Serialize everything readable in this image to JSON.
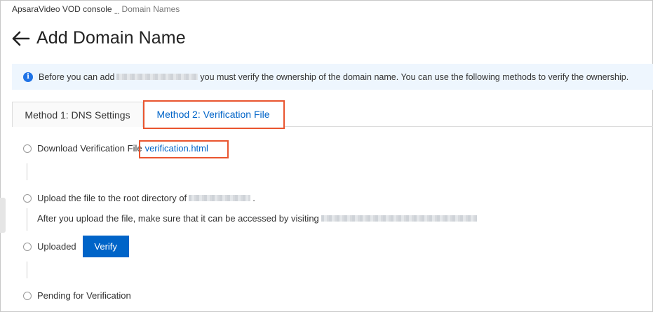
{
  "breadcrumb": {
    "item_1": "ApsaraVideo VOD console",
    "separator": "...",
    "item_2": "Domain Names"
  },
  "page": {
    "title": "Add Domain Name"
  },
  "info": {
    "text_before": "Before you can add",
    "text_after": "you must verify the ownership of the domain name. You can use the following methods to verify the ownership.",
    "icon": "info-icon"
  },
  "tabs": [
    {
      "label": "Method 1: DNS Settings",
      "active": false
    },
    {
      "label": "Method 2: Verification File",
      "active": true
    }
  ],
  "steps": {
    "download_label": "Download Verification File",
    "download_link": "verification.html",
    "upload_label": "Upload the file to the root directory of",
    "upload_suffix": ".",
    "upload_note": "After you upload the file, make sure that it can be accessed by visiting",
    "uploaded_label": "Uploaded",
    "verify_button": "Verify",
    "pending_label": "Pending for Verification"
  },
  "colors": {
    "accent": "#0064c8",
    "highlight": "#e9552f",
    "info_bg": "#eef6fe"
  }
}
